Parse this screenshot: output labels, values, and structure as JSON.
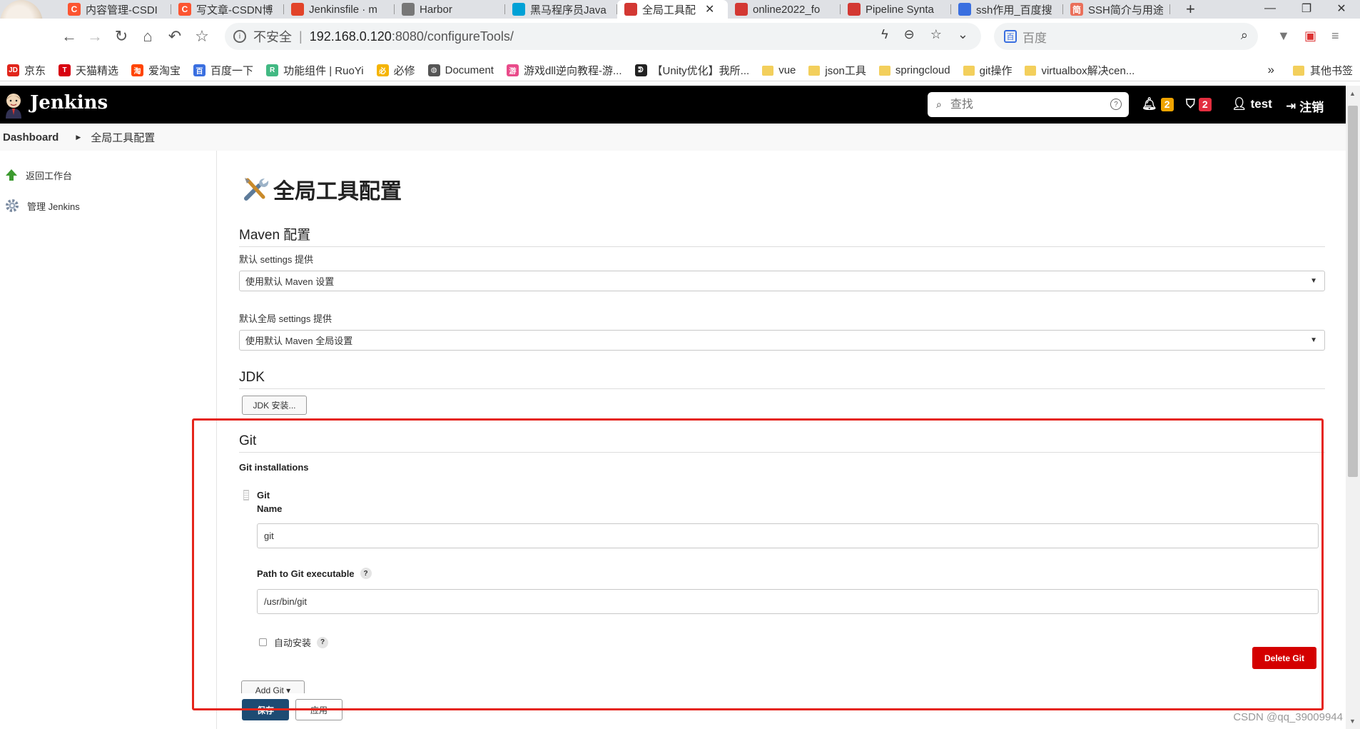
{
  "browser": {
    "tabs": [
      {
        "label": "内容管理-CSDI",
        "icon": "csdn-icon",
        "color": "#fc5531"
      },
      {
        "label": "写文章-CSDN博",
        "icon": "csdn-icon",
        "color": "#fc5531"
      },
      {
        "label": "Jenkinsfile · m",
        "icon": "gitlab-icon",
        "color": "#e24329"
      },
      {
        "label": "Harbor",
        "icon": "harbor-icon",
        "color": "#777777"
      },
      {
        "label": "黑马程序员Java",
        "icon": "bilibili-icon",
        "color": "#00a1d6"
      },
      {
        "label": "全局工具配",
        "icon": "jenkins-icon",
        "color": "#d33833"
      },
      {
        "label": "online2022_fo",
        "icon": "jenkins-icon",
        "color": "#d33833"
      },
      {
        "label": "Pipeline Synta",
        "icon": "jenkins-icon",
        "color": "#d33833"
      },
      {
        "label": "ssh作用_百度搜",
        "icon": "baidu-icon",
        "color": "#3a6fe0"
      },
      {
        "label": "SSH简介与用途",
        "icon": "jianshu-icon",
        "color": "#ea6f5a"
      }
    ],
    "active_tab_index": 5,
    "new_tab": "+",
    "url_insecure": "不安全",
    "url_host": "192.168.0.120",
    "url_path": ":8080/configureTools/",
    "search_placeholder": "百度",
    "bookmarks": [
      {
        "label": "京东",
        "icon": "jd-icon",
        "color": "#e1251b",
        "glyph": "JD"
      },
      {
        "label": "天猫精选",
        "icon": "tmall-icon",
        "color": "#d7000f",
        "glyph": "T"
      },
      {
        "label": "爱淘宝",
        "icon": "taobao-icon",
        "color": "#ff4400",
        "glyph": "淘"
      },
      {
        "label": "百度一下",
        "icon": "baidu-icon",
        "color": "#3a6fe0",
        "glyph": "百"
      },
      {
        "label": "功能组件 | RuoYi",
        "icon": "ruoyi-icon",
        "color": "#42b983",
        "glyph": "R"
      },
      {
        "label": "必修",
        "icon": "bixiu-icon",
        "color": "#f5b400",
        "glyph": "必"
      },
      {
        "label": "Document",
        "icon": "globe-icon",
        "color": "#555555",
        "glyph": "◍"
      },
      {
        "label": "游戏dll逆向教程-游...",
        "icon": "game-icon",
        "color": "#e94b8a",
        "glyph": "游"
      },
      {
        "label": "【Unity优化】我所...",
        "icon": "unity-icon",
        "color": "#222222",
        "glyph": "ᕲ"
      },
      {
        "label": "vue",
        "icon": "folder-icon",
        "folder": true
      },
      {
        "label": "json工具",
        "icon": "folder-icon",
        "folder": true
      },
      {
        "label": "springcloud",
        "icon": "folder-icon",
        "folder": true
      },
      {
        "label": "git操作",
        "icon": "folder-icon",
        "folder": true
      },
      {
        "label": "virtualbox解决cen...",
        "icon": "folder-icon",
        "folder": true
      }
    ],
    "bookmarks_more": "»",
    "other_bookmarks": "其他书签"
  },
  "jenkins": {
    "title": "Jenkins",
    "search_placeholder": "查找",
    "notifications_count": "2",
    "security_count": "2",
    "user": "test",
    "logout": "注销",
    "colors": {
      "header_bg": "#000000",
      "notif_badge": "#f0a400",
      "security_badge": "#e32e3f",
      "delete": "#d40000",
      "save": "#1d4b73"
    }
  },
  "breadcrumb": {
    "root": "Dashboard",
    "current": "全局工具配置"
  },
  "sidebar": {
    "items": [
      {
        "label": "返回工作台",
        "icon": "up-arrow-icon"
      },
      {
        "label": "管理 Jenkins",
        "icon": "gear-icon"
      }
    ]
  },
  "main": {
    "heading": "全局工具配置",
    "maven": {
      "title": "Maven 配置",
      "settings_label": "默认 settings 提供",
      "settings_value": "使用默认 Maven 设置",
      "global_settings_label": "默认全局 settings 提供",
      "global_settings_value": "使用默认 Maven 全局设置"
    },
    "jdk": {
      "title": "JDK",
      "install_button": "JDK 安装..."
    },
    "git": {
      "title": "Git",
      "installations_label": "Git installations",
      "entry_title": "Git",
      "name_label": "Name",
      "name_value": "git",
      "path_label": "Path to Git executable",
      "path_value": "/usr/bin/git",
      "auto_install_label": "自动安装",
      "auto_install_checked": false,
      "delete_button": "Delete Git",
      "add_button": "Add Git ▾"
    },
    "save_button": "保存",
    "apply_button": "应用"
  },
  "watermark": "CSDN @qq_39009944"
}
